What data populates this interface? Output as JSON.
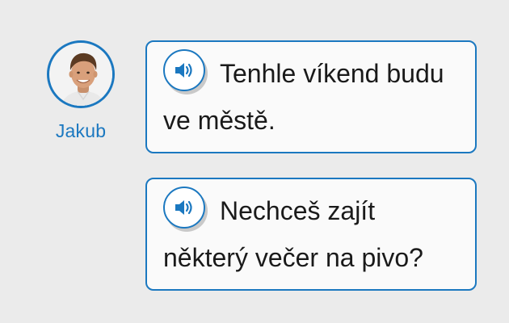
{
  "speaker": {
    "name": "Jakub",
    "avatar_icon": "person-avatar"
  },
  "messages": [
    {
      "text": "Tenhle víkend budu ve městě.",
      "audio_icon": "speaker-icon"
    },
    {
      "text": "Nechceš zajít některý večer na pivo?",
      "audio_icon": "speaker-icon"
    }
  ],
  "colors": {
    "accent": "#1b78c0",
    "background": "#ebebeb",
    "bubble_bg": "#fafafa",
    "text": "#1a1a1a"
  }
}
